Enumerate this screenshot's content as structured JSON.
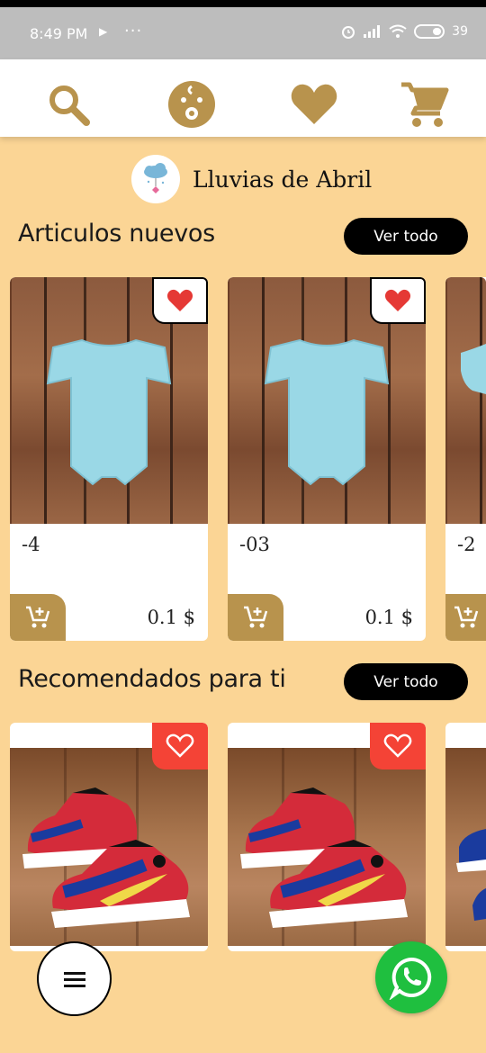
{
  "status_bar": {
    "time": "8:49 PM",
    "battery": "39"
  },
  "nav": {
    "icons": [
      "search-icon",
      "baby-face-icon",
      "heart-icon",
      "cart-icon"
    ],
    "icon_color": "#b8934d"
  },
  "brand": {
    "name": "Lluvias de Abril"
  },
  "sections": [
    {
      "title": "Articulos nuevos",
      "button": "Ver todo",
      "products": [
        {
          "name": "-4",
          "price": "0.1 $"
        },
        {
          "name": "-03",
          "price": "0.1 $"
        },
        {
          "name": "-2",
          "price": ""
        }
      ]
    },
    {
      "title": "Recomendados para ti",
      "button": "Ver todo",
      "products": [
        {
          "name": "",
          "price": ""
        },
        {
          "name": "",
          "price": ""
        }
      ]
    }
  ],
  "colors": {
    "background": "#fbd595",
    "accent": "#b8934d",
    "favorite_red": "#f44336",
    "whatsapp": "#1fbf3f"
  }
}
